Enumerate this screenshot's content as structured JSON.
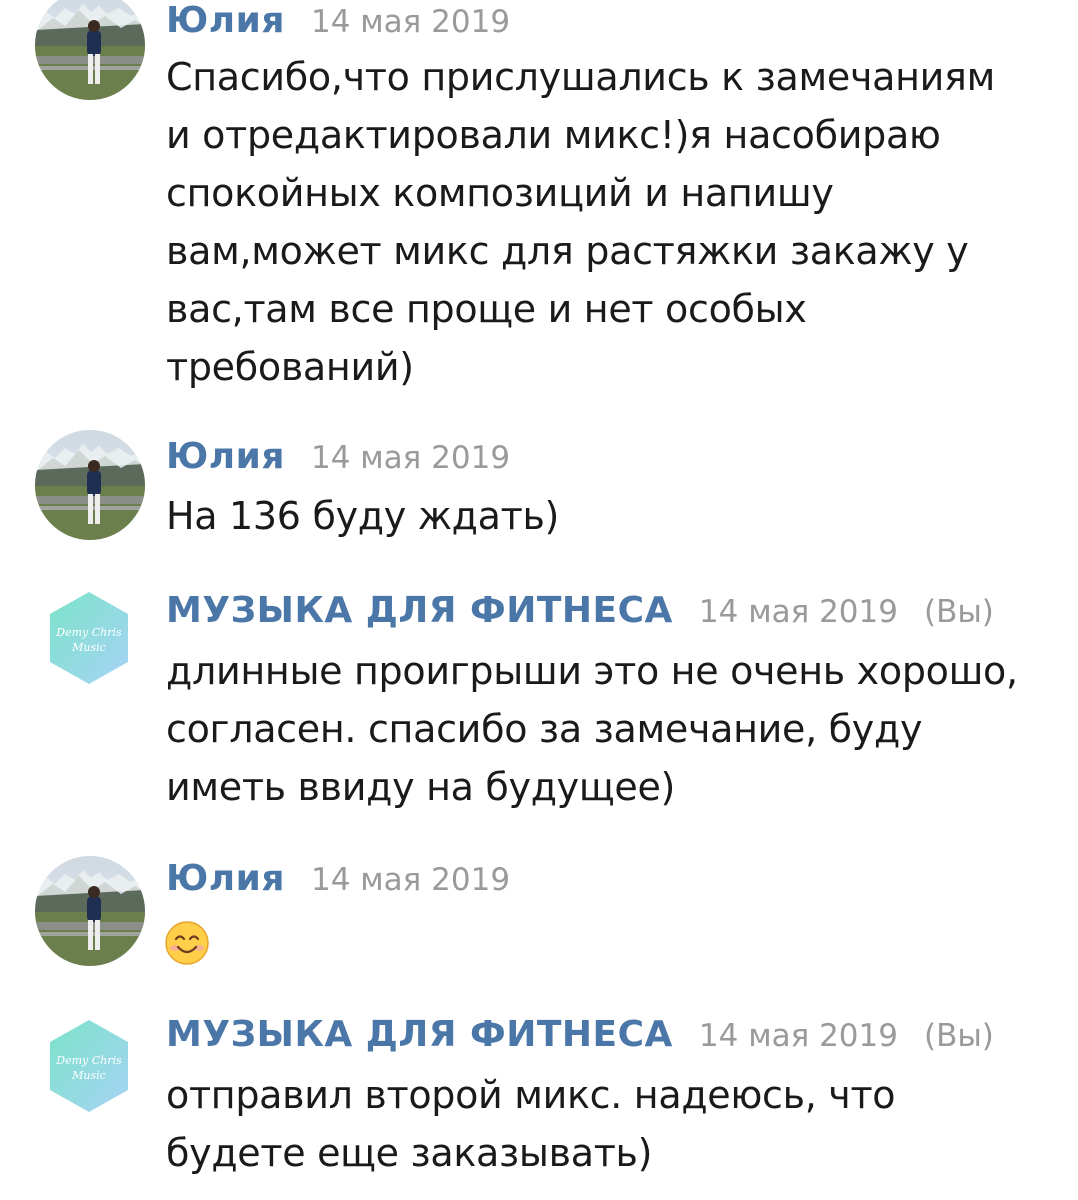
{
  "messages": [
    {
      "author": "Юлия",
      "date": "14 мая 2019",
      "avatar": "user-photo-avatar",
      "text": "Спасибо,что прислушались к замечаниям\nи отредактировали микс!)я насобираю\nспокойных композиций и напишу\nвам,может микс для растяжки закажу у\nвас,там все проще и нет особых\nтребований)"
    },
    {
      "author": "Юлия",
      "date": "14 мая 2019",
      "avatar": "user-photo-avatar",
      "text": "На 136 буду ждать)"
    },
    {
      "author": "МУЗЫКА ДЛЯ ФИТНЕСА",
      "date": "14 мая 2019",
      "you": "(Вы)",
      "avatar": "music-logo-avatar",
      "avatar_text": [
        "Demy Chris",
        "Music"
      ],
      "text": "длинные проигрыши это не очень хорошо,\nсогласен. спасибо за замечание, буду\nиметь ввиду на будущее)"
    },
    {
      "author": "Юлия",
      "date": "14 мая 2019",
      "avatar": "user-photo-avatar",
      "emoji": "smiling-face-emoji"
    },
    {
      "author": "МУЗЫКА ДЛЯ ФИТНЕСА",
      "date": "14 мая 2019",
      "you": "(Вы)",
      "avatar": "music-logo-avatar",
      "avatar_text": [
        "Demy Chris",
        "Music"
      ],
      "text": "отправил второй микс. надеюсь, что\nбудете еще заказывать)"
    }
  ],
  "colors": {
    "author": "#4a76a8",
    "date": "#9a9a9a",
    "text": "#1a1a1a",
    "logo_gradient_start": "#7be3c9",
    "logo_gradient_end": "#9fd2f2"
  }
}
